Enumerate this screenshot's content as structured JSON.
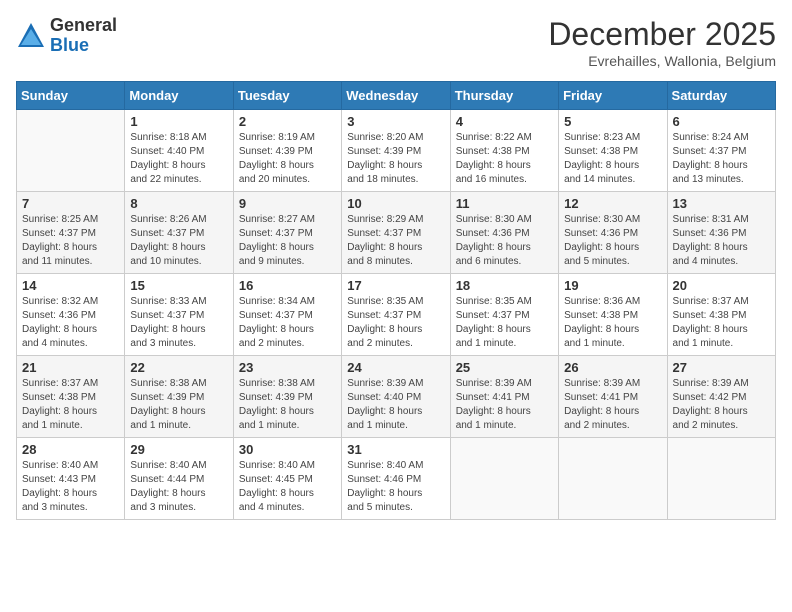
{
  "logo": {
    "general": "General",
    "blue": "Blue"
  },
  "title": "December 2025",
  "subtitle": "Evrehailles, Wallonia, Belgium",
  "days_header": [
    "Sunday",
    "Monday",
    "Tuesday",
    "Wednesday",
    "Thursday",
    "Friday",
    "Saturday"
  ],
  "weeks": [
    [
      {
        "day": "",
        "info": ""
      },
      {
        "day": "1",
        "info": "Sunrise: 8:18 AM\nSunset: 4:40 PM\nDaylight: 8 hours\nand 22 minutes."
      },
      {
        "day": "2",
        "info": "Sunrise: 8:19 AM\nSunset: 4:39 PM\nDaylight: 8 hours\nand 20 minutes."
      },
      {
        "day": "3",
        "info": "Sunrise: 8:20 AM\nSunset: 4:39 PM\nDaylight: 8 hours\nand 18 minutes."
      },
      {
        "day": "4",
        "info": "Sunrise: 8:22 AM\nSunset: 4:38 PM\nDaylight: 8 hours\nand 16 minutes."
      },
      {
        "day": "5",
        "info": "Sunrise: 8:23 AM\nSunset: 4:38 PM\nDaylight: 8 hours\nand 14 minutes."
      },
      {
        "day": "6",
        "info": "Sunrise: 8:24 AM\nSunset: 4:37 PM\nDaylight: 8 hours\nand 13 minutes."
      }
    ],
    [
      {
        "day": "7",
        "info": "Sunrise: 8:25 AM\nSunset: 4:37 PM\nDaylight: 8 hours\nand 11 minutes."
      },
      {
        "day": "8",
        "info": "Sunrise: 8:26 AM\nSunset: 4:37 PM\nDaylight: 8 hours\nand 10 minutes."
      },
      {
        "day": "9",
        "info": "Sunrise: 8:27 AM\nSunset: 4:37 PM\nDaylight: 8 hours\nand 9 minutes."
      },
      {
        "day": "10",
        "info": "Sunrise: 8:29 AM\nSunset: 4:37 PM\nDaylight: 8 hours\nand 8 minutes."
      },
      {
        "day": "11",
        "info": "Sunrise: 8:30 AM\nSunset: 4:36 PM\nDaylight: 8 hours\nand 6 minutes."
      },
      {
        "day": "12",
        "info": "Sunrise: 8:30 AM\nSunset: 4:36 PM\nDaylight: 8 hours\nand 5 minutes."
      },
      {
        "day": "13",
        "info": "Sunrise: 8:31 AM\nSunset: 4:36 PM\nDaylight: 8 hours\nand 4 minutes."
      }
    ],
    [
      {
        "day": "14",
        "info": "Sunrise: 8:32 AM\nSunset: 4:36 PM\nDaylight: 8 hours\nand 4 minutes."
      },
      {
        "day": "15",
        "info": "Sunrise: 8:33 AM\nSunset: 4:37 PM\nDaylight: 8 hours\nand 3 minutes."
      },
      {
        "day": "16",
        "info": "Sunrise: 8:34 AM\nSunset: 4:37 PM\nDaylight: 8 hours\nand 2 minutes."
      },
      {
        "day": "17",
        "info": "Sunrise: 8:35 AM\nSunset: 4:37 PM\nDaylight: 8 hours\nand 2 minutes."
      },
      {
        "day": "18",
        "info": "Sunrise: 8:35 AM\nSunset: 4:37 PM\nDaylight: 8 hours\nand 1 minute."
      },
      {
        "day": "19",
        "info": "Sunrise: 8:36 AM\nSunset: 4:38 PM\nDaylight: 8 hours\nand 1 minute."
      },
      {
        "day": "20",
        "info": "Sunrise: 8:37 AM\nSunset: 4:38 PM\nDaylight: 8 hours\nand 1 minute."
      }
    ],
    [
      {
        "day": "21",
        "info": "Sunrise: 8:37 AM\nSunset: 4:38 PM\nDaylight: 8 hours\nand 1 minute."
      },
      {
        "day": "22",
        "info": "Sunrise: 8:38 AM\nSunset: 4:39 PM\nDaylight: 8 hours\nand 1 minute."
      },
      {
        "day": "23",
        "info": "Sunrise: 8:38 AM\nSunset: 4:39 PM\nDaylight: 8 hours\nand 1 minute."
      },
      {
        "day": "24",
        "info": "Sunrise: 8:39 AM\nSunset: 4:40 PM\nDaylight: 8 hours\nand 1 minute."
      },
      {
        "day": "25",
        "info": "Sunrise: 8:39 AM\nSunset: 4:41 PM\nDaylight: 8 hours\nand 1 minute."
      },
      {
        "day": "26",
        "info": "Sunrise: 8:39 AM\nSunset: 4:41 PM\nDaylight: 8 hours\nand 2 minutes."
      },
      {
        "day": "27",
        "info": "Sunrise: 8:39 AM\nSunset: 4:42 PM\nDaylight: 8 hours\nand 2 minutes."
      }
    ],
    [
      {
        "day": "28",
        "info": "Sunrise: 8:40 AM\nSunset: 4:43 PM\nDaylight: 8 hours\nand 3 minutes."
      },
      {
        "day": "29",
        "info": "Sunrise: 8:40 AM\nSunset: 4:44 PM\nDaylight: 8 hours\nand 3 minutes."
      },
      {
        "day": "30",
        "info": "Sunrise: 8:40 AM\nSunset: 4:45 PM\nDaylight: 8 hours\nand 4 minutes."
      },
      {
        "day": "31",
        "info": "Sunrise: 8:40 AM\nSunset: 4:46 PM\nDaylight: 8 hours\nand 5 minutes."
      },
      {
        "day": "",
        "info": ""
      },
      {
        "day": "",
        "info": ""
      },
      {
        "day": "",
        "info": ""
      }
    ]
  ]
}
